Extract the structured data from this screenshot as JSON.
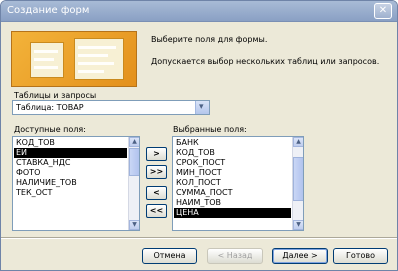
{
  "window": {
    "title": "Создание форм",
    "close_glyph": "✕"
  },
  "intro": {
    "line1": "Выберите поля для формы.",
    "line2": "Допускается выбор нескольких таблиц или запросов."
  },
  "tables": {
    "label": "Таблицы и запросы",
    "selected": "Таблица: ТОВАР",
    "arrow": "▾"
  },
  "available": {
    "label": "Доступные поля:",
    "items": [
      "КОД_ТОВ",
      "ЕИ",
      "СТАВКА_НДС",
      "ФОТО",
      "НАЛИЧИЕ_ТОВ",
      "ТЕК_ОСТ"
    ],
    "selected_index": 1
  },
  "selected_fields": {
    "label": "Выбранные поля:",
    "items": [
      "БАНК",
      "КОД_ТОВ",
      "СРОК_ПОСТ",
      "МИН_ПОСТ",
      "КОЛ_ПОСТ",
      "СУММА_ПОСТ",
      "НАИМ_ТОВ",
      "ЦЕНА"
    ],
    "selected_index": 7
  },
  "move_buttons": {
    "add_one": ">",
    "add_all": ">>",
    "remove_one": "<",
    "remove_all": "<<"
  },
  "buttons": {
    "cancel": "Отмена",
    "back": "< Назад",
    "next": "Далее >",
    "finish": "Готово"
  },
  "scroll": {
    "up": "▲",
    "down": "▼"
  },
  "colors": {
    "accent": "#f3b33a",
    "selection": "#000000"
  }
}
